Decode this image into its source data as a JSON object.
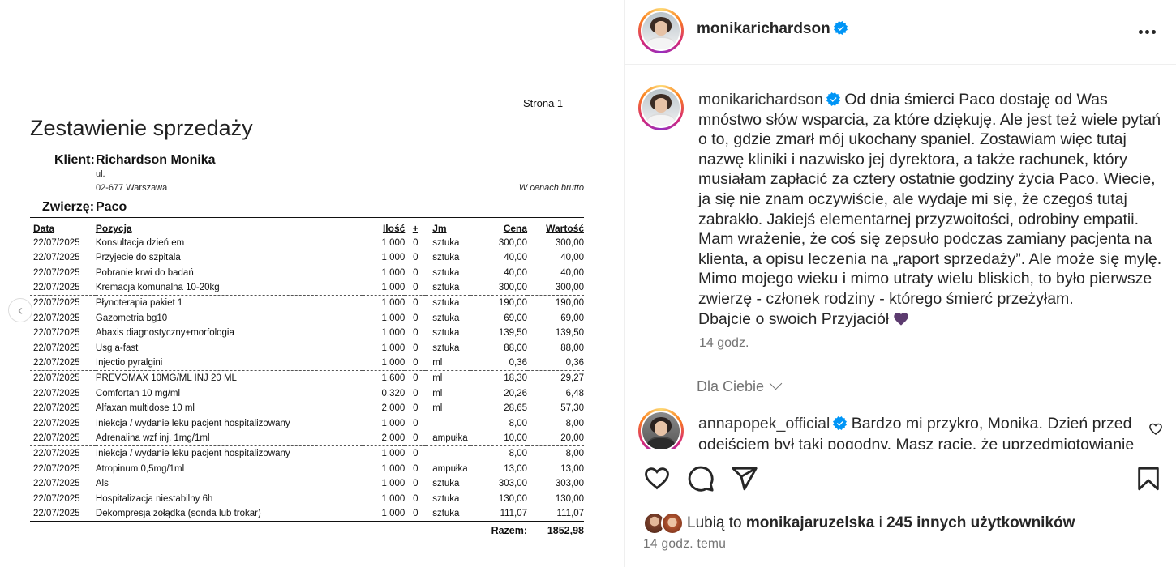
{
  "document": {
    "page_label": "Strona 1",
    "title": "Zestawienie sprzedaży",
    "client_label": "Klient:",
    "client_name": "Richardson Monika",
    "client_street": "ul.",
    "client_city": "02-677 Warszawa",
    "price_note": "W cenach brutto",
    "animal_label": "Zwierzę:",
    "animal_name": "Paco",
    "columns": [
      "Data",
      "Pozycja",
      "Ilość",
      "+",
      "Jm",
      "Cena",
      "Wartość"
    ],
    "rows": [
      {
        "date": "22/07/2025",
        "item": "Konsultacja dzień em",
        "qty": "1,000",
        "plus": "0",
        "unit": "sztuka",
        "price": "300,00",
        "value": "300,00",
        "dashed": false
      },
      {
        "date": "22/07/2025",
        "item": "Przyjecie do szpitala",
        "qty": "1,000",
        "plus": "0",
        "unit": "sztuka",
        "price": "40,00",
        "value": "40,00",
        "dashed": false
      },
      {
        "date": "22/07/2025",
        "item": "Pobranie krwi do badań",
        "qty": "1,000",
        "plus": "0",
        "unit": "sztuka",
        "price": "40,00",
        "value": "40,00",
        "dashed": false
      },
      {
        "date": "22/07/2025",
        "item": "Kremacja komunalna 10-20kg",
        "qty": "1,000",
        "plus": "0",
        "unit": "sztuka",
        "price": "300,00",
        "value": "300,00",
        "dashed": false
      },
      {
        "date": "22/07/2025",
        "item": "Płynoterapia pakiet 1",
        "qty": "1,000",
        "plus": "0",
        "unit": "sztuka",
        "price": "190,00",
        "value": "190,00",
        "dashed": true
      },
      {
        "date": "22/07/2025",
        "item": "Gazometria bg10",
        "qty": "1,000",
        "plus": "0",
        "unit": "sztuka",
        "price": "69,00",
        "value": "69,00",
        "dashed": false
      },
      {
        "date": "22/07/2025",
        "item": "Abaxis diagnostyczny+morfologia",
        "qty": "1,000",
        "plus": "0",
        "unit": "sztuka",
        "price": "139,50",
        "value": "139,50",
        "dashed": false
      },
      {
        "date": "22/07/2025",
        "item": "Usg a-fast",
        "qty": "1,000",
        "plus": "0",
        "unit": "sztuka",
        "price": "88,00",
        "value": "88,00",
        "dashed": false
      },
      {
        "date": "22/07/2025",
        "item": "Injectio pyralgini",
        "qty": "1,000",
        "plus": "0",
        "unit": "ml",
        "price": "0,36",
        "value": "0,36",
        "dashed": false
      },
      {
        "date": "22/07/2025",
        "item": "PREVOMAX 10MG/ML INJ 20 ML",
        "qty": "1,600",
        "plus": "0",
        "unit": "ml",
        "price": "18,30",
        "value": "29,27",
        "dashed": true
      },
      {
        "date": "22/07/2025",
        "item": "Comfortan 10 mg/ml",
        "qty": "0,320",
        "plus": "0",
        "unit": "ml",
        "price": "20,26",
        "value": "6,48",
        "dashed": false
      },
      {
        "date": "22/07/2025",
        "item": "Alfaxan multidose 10 ml",
        "qty": "2,000",
        "plus": "0",
        "unit": "ml",
        "price": "28,65",
        "value": "57,30",
        "dashed": false
      },
      {
        "date": "22/07/2025",
        "item": "Iniekcja / wydanie leku pacjent hospitalizowany",
        "qty": "1,000",
        "plus": "0",
        "unit": "",
        "price": "8,00",
        "value": "8,00",
        "dashed": false
      },
      {
        "date": "22/07/2025",
        "item": "Adrenalina wzf inj. 1mg/1ml",
        "qty": "2,000",
        "plus": "0",
        "unit": "ampułka",
        "price": "10,00",
        "value": "20,00",
        "dashed": false
      },
      {
        "date": "22/07/2025",
        "item": "Iniekcja / wydanie leku pacjent hospitalizowany",
        "qty": "1,000",
        "plus": "0",
        "unit": "",
        "price": "8,00",
        "value": "8,00",
        "dashed": true
      },
      {
        "date": "22/07/2025",
        "item": "Atropinum 0,5mg/1ml",
        "qty": "1,000",
        "plus": "0",
        "unit": "ampułka",
        "price": "13,00",
        "value": "13,00",
        "dashed": false
      },
      {
        "date": "22/07/2025",
        "item": "Als",
        "qty": "1,000",
        "plus": "0",
        "unit": "sztuka",
        "price": "303,00",
        "value": "303,00",
        "dashed": false
      },
      {
        "date": "22/07/2025",
        "item": "Hospitalizacja niestabilny 6h",
        "qty": "1,000",
        "plus": "0",
        "unit": "sztuka",
        "price": "130,00",
        "value": "130,00",
        "dashed": false
      },
      {
        "date": "22/07/2025",
        "item": "Dekompresja żołądka (sonda lub trokar)",
        "qty": "1,000",
        "plus": "0",
        "unit": "sztuka",
        "price": "111,07",
        "value": "111,07",
        "dashed": false
      }
    ],
    "total_label": "Razem:",
    "total_value": "1852,98"
  },
  "post": {
    "author": "monikarichardson",
    "caption_author": "monikarichardson",
    "caption_text": "Od dnia śmierci Paco dostaję od Was mnóstwo słów wsparcia, za które dziękuję. Ale jest też wiele pytań o to, gdzie zmarł mój ukochany spaniel. Zostawiam więc tutaj nazwę kliniki i nazwisko jej dyrektora, a także rachunek, który musiałam zapłacić za cztery ostatnie godziny życia Paco. Wiecie, ja się nie znam oczywiście, ale wydaje mi się, że czegoś tutaj zabrakło. Jakiejś elementarnej przyzwoitości, odrobiny empatii. Mam wrażenie, że coś się zepsuło podczas zamiany pacjenta na klienta, a opisu leczenia na „raport sprzedaży”. Ale może się mylę. Mimo mojego wieku i mimo utraty wielu bliskich, to było pierwsze zwierzę - członek rodziny - którego śmierć przeżyłam.",
    "caption_last_line": "Dbajcie o swoich Przyjaciół",
    "caption_time": "14 godz.",
    "filter_label": "Dla Ciebie",
    "comment": {
      "author": "annapopek_official",
      "text": "Bardzo mi przykro, Monika. Dzień przed odejściem był taki pogodny. Masz rację, że uprzedmiotowianie"
    },
    "likes_prefix": "Lubią to",
    "likes_user": "monikajaruzelska",
    "likes_joiner": "i",
    "likes_others": "245 innych użytkowników",
    "post_time": "14 godz. temu"
  },
  "icons": {
    "verified": "verified-badge-icon",
    "more": "more-options-icon",
    "like": "heart-icon",
    "comment": "comment-icon",
    "share": "share-icon",
    "save": "bookmark-icon",
    "carousel_prev": "chevron-left-icon",
    "emoji": "purple-heart-icon"
  },
  "colors": {
    "verified": "#0095f6",
    "muted_text": "#737373",
    "text": "#262626",
    "heart_emoji": "#5c3b6f"
  }
}
